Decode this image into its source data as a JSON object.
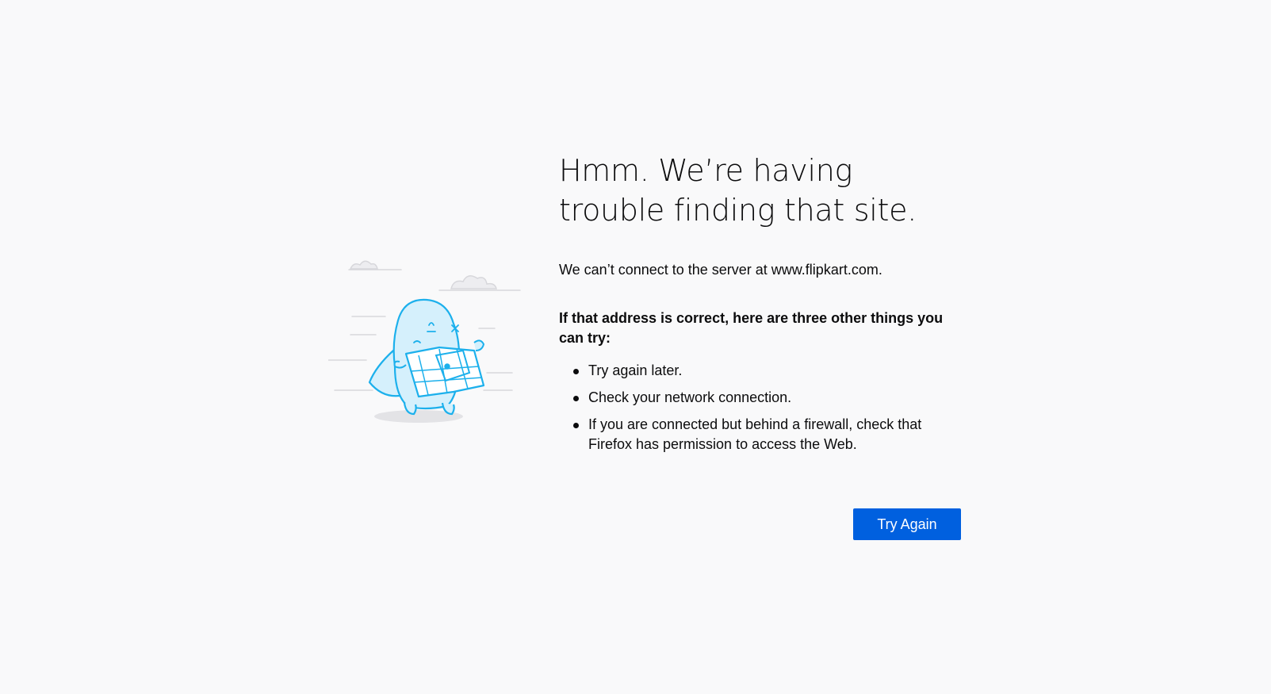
{
  "error_page": {
    "title": "Hmm. We’re having trouble finding that site.",
    "short_description": "We can’t connect to the server at www.flipkart.com.",
    "tips_heading": "If that address is correct, here are three other things you can try:",
    "tips": [
      "Try again later.",
      "Check your network connection.",
      "If you are connected but behind a firewall, check that Firefox has permission to access the Web."
    ],
    "try_again_label": "Try Again"
  },
  "colors": {
    "background": "#f9f9fa",
    "text": "#0c0c0d",
    "button": "#0060df",
    "illustration_stroke": "#1cb0ec",
    "illustration_fill": "#d5f0fc"
  }
}
